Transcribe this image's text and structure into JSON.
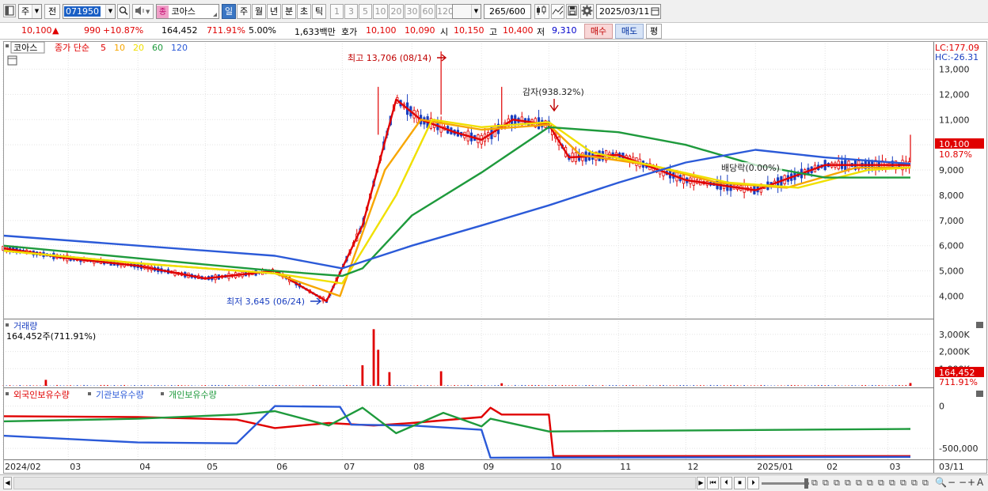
{
  "toolbar": {
    "type_value": "주",
    "prefix_label": "전",
    "code_value": "071950",
    "name_badge": "종",
    "name_value": "코아스",
    "periods": [
      "일",
      "주",
      "월",
      "년",
      "분",
      "초",
      "틱"
    ],
    "period_selected": 0,
    "intervals": [
      "1",
      "3",
      "5",
      "10",
      "20",
      "30",
      "60",
      "120"
    ],
    "count_value": "265",
    "count_total": "/600",
    "date_value": "2025/03/11"
  },
  "info": {
    "price": "10,100",
    "arrow": "▲",
    "change": "990",
    "change_pct": "+10.87%",
    "volume": "164,452",
    "volume_pct": "711.91%",
    "ratio": "5.00%",
    "amount": "1,633백만",
    "bid_label": "호가",
    "bid1": "10,100",
    "bid2": "10,090",
    "open_label": "시",
    "open": "10,150",
    "high_label": "고",
    "high": "10,400",
    "low_label": "저",
    "low": "9,310",
    "buy_label": "매수",
    "sell_label": "매도",
    "eval_label": "평"
  },
  "price_panel": {
    "stock_name": "코아스",
    "legend_title": "종가 단순",
    "ma": [
      {
        "label": "5",
        "color": "#e00000"
      },
      {
        "label": "10",
        "color": "#f7a600"
      },
      {
        "label": "20",
        "color": "#f0e000"
      },
      {
        "label": "60",
        "color": "#1e9a3c"
      },
      {
        "label": "120",
        "color": "#2b5ad8"
      }
    ],
    "lc": "LC:177.09",
    "hc": "HC:-26.31",
    "current_price_tag": "10,100",
    "current_pct_tag": "10.87%",
    "annotations": {
      "high": "최고 13,706 (08/14)",
      "reduction": "감자(938.32%)",
      "dividend": "배당락(0.00%)",
      "low": "최저 3,645 (06/24)"
    }
  },
  "volume_panel": {
    "title": "거래량",
    "value": "164,452주(711.91%)",
    "current_tag": "164,452",
    "current_pct": "711.91%"
  },
  "holdings_panel": {
    "legend": [
      {
        "label": "외국인보유수량",
        "color": "#e00000"
      },
      {
        "label": "기관보유수량",
        "color": "#2b5ad8"
      },
      {
        "label": "개인보유수량",
        "color": "#1e9a3c"
      }
    ]
  },
  "chart_data": [
    {
      "type": "candlestick",
      "title": "코아스",
      "y_ticks": [
        "13,000",
        "12,000",
        "11,000",
        "10,000",
        "9,000",
        "8,000",
        "7,000",
        "6,000",
        "5,000",
        "4,000"
      ],
      "ylim": [
        3200,
        13800
      ],
      "x_range": [
        "2024-02-01",
        "2025-03-11"
      ],
      "x_ticks": [
        "2024/02",
        "03",
        "04",
        "05",
        "06",
        "07",
        "08",
        "09",
        "10",
        "11",
        "12",
        "2025/01",
        "02",
        "03",
        "03/11"
      ],
      "series": [
        {
          "name": "5",
          "points": [
            [
              "2024-02-01",
              5900
            ],
            [
              "2024-03-01",
              5500
            ],
            [
              "2024-04-01",
              5200
            ],
            [
              "2024-05-01",
              4700
            ],
            [
              "2024-06-01",
              5000
            ],
            [
              "2024-06-24",
              3800
            ],
            [
              "2024-07-10",
              6800
            ],
            [
              "2024-07-25",
              11800
            ],
            [
              "2024-08-05",
              11000
            ],
            [
              "2024-08-20",
              10500
            ],
            [
              "2024-09-01",
              10200
            ],
            [
              "2024-09-15",
              11000
            ],
            [
              "2024-10-01",
              10800
            ],
            [
              "2024-10-10",
              9500
            ],
            [
              "2024-11-01",
              9600
            ],
            [
              "2024-12-01",
              8600
            ],
            [
              "2025-01-01",
              8200
            ],
            [
              "2025-02-01",
              9200
            ],
            [
              "2025-03-11",
              9200
            ]
          ]
        },
        {
          "name": "10",
          "points": [
            [
              "2024-02-01",
              5800
            ],
            [
              "2024-04-01",
              5300
            ],
            [
              "2024-06-01",
              4900
            ],
            [
              "2024-06-30",
              4000
            ],
            [
              "2024-07-20",
              9000
            ],
            [
              "2024-08-05",
              11000
            ],
            [
              "2024-09-01",
              10600
            ],
            [
              "2024-10-01",
              10800
            ],
            [
              "2024-10-15",
              9600
            ],
            [
              "2024-11-15",
              9200
            ],
            [
              "2024-12-15",
              8500
            ],
            [
              "2025-01-15",
              8300
            ],
            [
              "2025-02-15",
              9100
            ],
            [
              "2025-03-11",
              9100
            ]
          ]
        },
        {
          "name": "20",
          "points": [
            [
              "2024-02-01",
              5800
            ],
            [
              "2024-04-01",
              5300
            ],
            [
              "2024-06-01",
              4900
            ],
            [
              "2024-07-01",
              4500
            ],
            [
              "2024-07-25",
              8000
            ],
            [
              "2024-08-10",
              11000
            ],
            [
              "2024-09-01",
              10700
            ],
            [
              "2024-10-01",
              10900
            ],
            [
              "2024-10-20",
              9700
            ],
            [
              "2024-11-20",
              9100
            ],
            [
              "2024-12-20",
              8500
            ],
            [
              "2025-01-20",
              8300
            ],
            [
              "2025-02-20",
              9000
            ],
            [
              "2025-03-11",
              9100
            ]
          ]
        },
        {
          "name": "60",
          "points": [
            [
              "2024-02-01",
              6000
            ],
            [
              "2024-04-01",
              5500
            ],
            [
              "2024-06-01",
              5000
            ],
            [
              "2024-07-01",
              4800
            ],
            [
              "2024-07-10",
              5100
            ],
            [
              "2024-08-01",
              7200
            ],
            [
              "2024-09-01",
              8900
            ],
            [
              "2024-10-01",
              10700
            ],
            [
              "2024-11-01",
              10500
            ],
            [
              "2024-12-01",
              10000
            ],
            [
              "2025-01-01",
              9200
            ],
            [
              "2025-02-01",
              8700
            ],
            [
              "2025-03-11",
              8700
            ]
          ]
        },
        {
          "name": "120",
          "points": [
            [
              "2024-02-01",
              6400
            ],
            [
              "2024-04-01",
              6000
            ],
            [
              "2024-06-01",
              5600
            ],
            [
              "2024-07-01",
              5100
            ],
            [
              "2024-08-01",
              6000
            ],
            [
              "2024-09-01",
              6800
            ],
            [
              "2024-10-01",
              7600
            ],
            [
              "2024-11-01",
              8500
            ],
            [
              "2024-12-01",
              9300
            ],
            [
              "2025-01-01",
              9800
            ],
            [
              "2025-02-01",
              9500
            ],
            [
              "2025-03-11",
              9250
            ]
          ]
        }
      ]
    },
    {
      "type": "bar",
      "title": "거래량",
      "y_ticks": [
        "3,000K",
        "2,000K",
        "1,000K"
      ],
      "ylim": [
        0,
        3500
      ],
      "series": [
        {
          "name": "거래량",
          "points": [
            [
              "2024-02-20",
              350
            ],
            [
              "2024-07-10",
              1200
            ],
            [
              "2024-07-15",
              3300
            ],
            [
              "2024-07-17",
              2100
            ],
            [
              "2024-07-22",
              800
            ],
            [
              "2024-08-14",
              850
            ],
            [
              "2024-09-10",
              150
            ],
            [
              "2025-03-11",
              164
            ]
          ]
        }
      ]
    },
    {
      "type": "line",
      "title": "보유수량",
      "y_ticks": [
        "0",
        "-500,000"
      ],
      "ylim": [
        -620000,
        80000
      ],
      "series": [
        {
          "name": "외국인보유수량",
          "points": [
            [
              "2024-02-01",
              -120000
            ],
            [
              "2024-04-01",
              -130000
            ],
            [
              "2024-05-15",
              -160000
            ],
            [
              "2024-06-01",
              -260000
            ],
            [
              "2024-06-25",
              -200000
            ],
            [
              "2024-07-15",
              -230000
            ],
            [
              "2024-08-01",
              -200000
            ],
            [
              "2024-09-01",
              -130000
            ],
            [
              "2024-09-05",
              -20000
            ],
            [
              "2024-09-10",
              -100000
            ],
            [
              "2024-10-01",
              -100000
            ],
            [
              "2024-10-03",
              -590000
            ],
            [
              "2025-03-11",
              -590000
            ]
          ]
        },
        {
          "name": "기관보유수량",
          "points": [
            [
              "2024-02-01",
              -350000
            ],
            [
              "2024-04-01",
              -430000
            ],
            [
              "2024-05-15",
              -440000
            ],
            [
              "2024-06-01",
              0
            ],
            [
              "2024-06-30",
              -10000
            ],
            [
              "2024-07-05",
              -220000
            ],
            [
              "2024-08-01",
              -230000
            ],
            [
              "2024-09-01",
              -280000
            ],
            [
              "2024-09-05",
              -610000
            ],
            [
              "2025-03-11",
              -600000
            ]
          ]
        },
        {
          "name": "개인보유수량",
          "points": [
            [
              "2024-02-01",
              -180000
            ],
            [
              "2024-04-01",
              -150000
            ],
            [
              "2024-05-15",
              -100000
            ],
            [
              "2024-06-01",
              -60000
            ],
            [
              "2024-06-25",
              -230000
            ],
            [
              "2024-07-10",
              -20000
            ],
            [
              "2024-07-25",
              -320000
            ],
            [
              "2024-08-15",
              -80000
            ],
            [
              "2024-09-01",
              -240000
            ],
            [
              "2024-09-05",
              -150000
            ],
            [
              "2024-10-01",
              -300000
            ],
            [
              "2025-03-11",
              -270000
            ]
          ]
        }
      ]
    }
  ]
}
